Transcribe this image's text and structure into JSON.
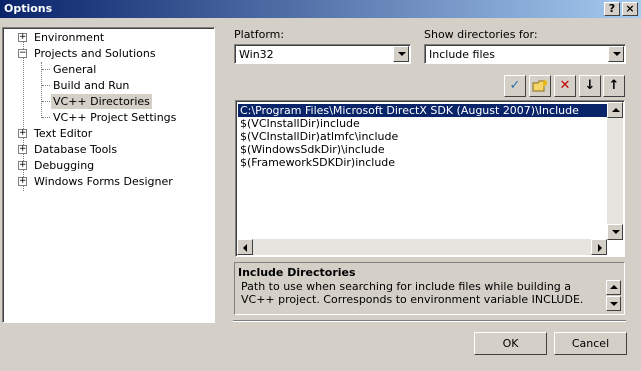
{
  "window": {
    "title": "Options",
    "help_button": "?",
    "close_button": "×"
  },
  "tree": {
    "items": [
      {
        "label": "Environment",
        "expander": "+"
      },
      {
        "label": "Projects and Solutions",
        "expander": "−"
      },
      {
        "label": "General"
      },
      {
        "label": "Build and Run"
      },
      {
        "label": "VC++ Directories",
        "selected": true
      },
      {
        "label": "VC++ Project Settings"
      },
      {
        "label": "Text Editor",
        "expander": "+"
      },
      {
        "label": "Database Tools",
        "expander": "+"
      },
      {
        "label": "Debugging",
        "expander": "+"
      },
      {
        "label": "Windows Forms Designer",
        "expander": "+"
      }
    ]
  },
  "platform": {
    "label": "Platform:",
    "value": "Win32"
  },
  "show_dirs": {
    "label": "Show directories for:",
    "value": "Include files"
  },
  "toolbar": {
    "ok_icon": "✓",
    "delete_icon": "✕",
    "down_icon": "↓",
    "up_icon": "↑"
  },
  "directories": [
    "C:\\Program Files\\Microsoft DirectX SDK (August 2007)\\Include",
    "$(VCInstallDir)include",
    "$(VCInstallDir)atlmfc\\include",
    "$(WindowsSdkDir)\\include",
    "$(FrameworkSDKDir)include"
  ],
  "description": {
    "title": "Include Directories",
    "text": "Path to use when searching for include files while building a VC++ project. Corresponds to environment variable INCLUDE."
  },
  "buttons": {
    "ok": "OK",
    "cancel": "Cancel"
  },
  "colors": {
    "title_start": "#0a246a",
    "title_end": "#a6caf0",
    "selection": "#0a246a",
    "face": "#d4d0c8"
  }
}
